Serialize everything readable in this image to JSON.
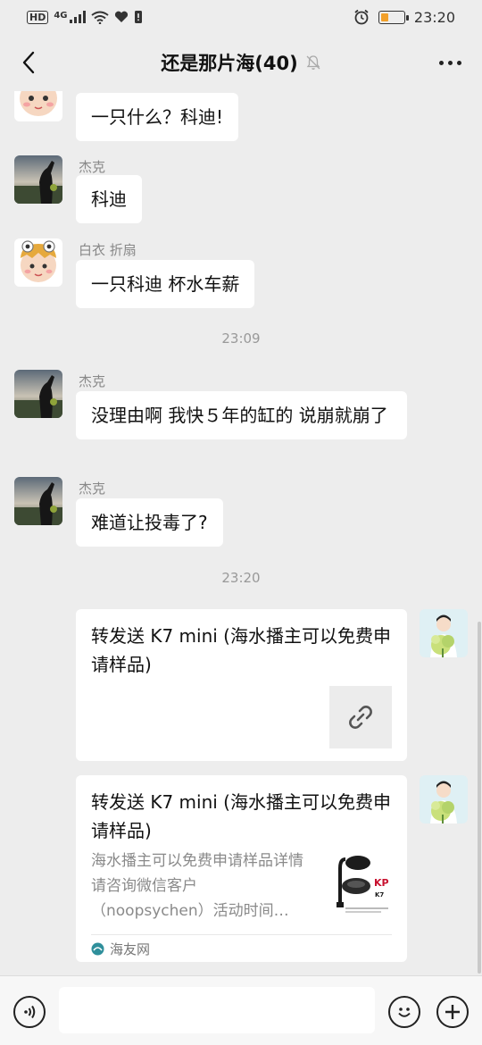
{
  "status_bar": {
    "hd": "HD",
    "network": "4G",
    "time": "23:20"
  },
  "header": {
    "title": "还是那片海(40)",
    "back_icon": "chevron-left-icon",
    "mute_icon": "bell-off-icon",
    "more_icon": "more-dots-icon"
  },
  "messages": [
    {
      "sender": "",
      "text": "一只什么？科迪!"
    },
    {
      "sender": "杰克",
      "text": "科迪"
    },
    {
      "sender": "白衣 折扇",
      "text": "一只科迪 杯水车薪"
    },
    {
      "time": "23:09"
    },
    {
      "sender": "杰克",
      "text": "没理由啊 我快５年的缸的 说崩就崩了"
    },
    {
      "sender": "杰克",
      "text": "难道让投毒了?"
    },
    {
      "time": "23:20"
    },
    {
      "card_title": "转发送 K7 mini (海水播主可以免费申请样品)",
      "link_icon": "link-icon"
    },
    {
      "card_title": "转发送 K7 mini (海水播主可以免费申请样品)",
      "card_desc": "海水播主可以免费申请样品详情请咨询微信客户（noopsychen）活动时间…",
      "source": "海友网",
      "thumb_brand": "KP",
      "thumb_model": "K7"
    }
  ],
  "input_bar": {
    "voice_icon": "voice-icon",
    "emoji_icon": "emoji-icon",
    "plus_icon": "plus-icon"
  },
  "colors": {
    "background": "#ededed",
    "bubble": "#ffffff",
    "meta_text": "#999999"
  }
}
